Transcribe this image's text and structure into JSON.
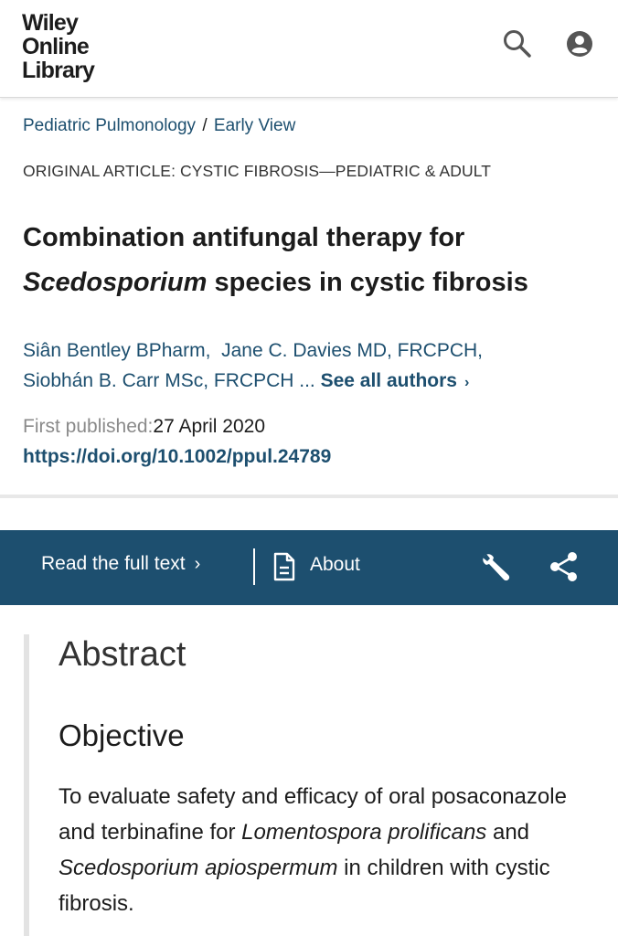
{
  "header": {
    "logo": [
      "Wiley",
      "Online",
      "Library"
    ]
  },
  "breadcrumb": {
    "journal": "Pediatric Pulmonology",
    "separator": "/",
    "section": "Early View"
  },
  "article": {
    "category": "ORIGINAL ARTICLE: CYSTIC FIBROSIS—PEDIATRIC & ADULT",
    "title": {
      "part1": "Combination antifungal therapy for",
      "italic": "Scedosporium",
      "part2": " species in cystic fibrosis"
    },
    "authors": [
      "Siân Bentley BPharm,",
      "Jane C. Davies MD, FRCPCH,",
      "Siobhán B. Carr MSc, FRCPCH ..."
    ],
    "see_all": "See all authors",
    "published_label": "First published:",
    "published_date": "27 April 2020",
    "doi": "https://doi.org/10.1002/ppul.24789"
  },
  "toolbar": {
    "read_full": "Read the full text",
    "about": "About"
  },
  "abstract": {
    "heading": "Abstract",
    "objective_heading": "Objective",
    "objective_text": {
      "t1": "To evaluate safety and efficacy of oral posaconazole and terbinafine for ",
      "i1": "Lomentospora prolificans",
      "t2": " and ",
      "i2": "Scedosporium apiospermum",
      "t3": " in children with cystic fibrosis."
    }
  },
  "colors": {
    "brand": "#1d4f6f",
    "toolbar_bg": "#1d4f6f",
    "text": "#1c1c1c",
    "muted": "#8a8a8a"
  },
  "icons": [
    "search-icon",
    "account-icon",
    "chevron-right-icon",
    "document-icon",
    "wrench-icon",
    "share-icon"
  ]
}
